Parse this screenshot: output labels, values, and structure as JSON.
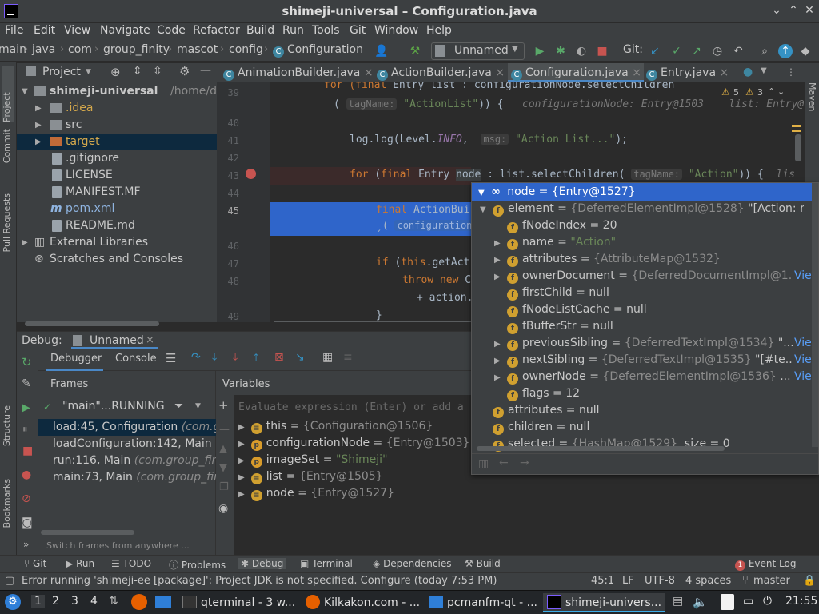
{
  "window": {
    "title": "shimeji-universal – Configuration.java"
  },
  "menu": [
    "File",
    "Edit",
    "View",
    "Navigate",
    "Code",
    "Refactor",
    "Build",
    "Run",
    "Tools",
    "Git",
    "Window",
    "Help"
  ],
  "breadcrumbs": [
    "main",
    "java",
    "com",
    "group_finity",
    "mascot",
    "config",
    "Configuration"
  ],
  "run_config": "Unnamed",
  "git_label": "Git:",
  "project_panel": {
    "title": "Project",
    "root_name": "shimeji-universal",
    "root_path": "/home/dartz",
    "items": [
      ".idea",
      "src",
      "target",
      ".gitignore",
      "LICENSE",
      "MANIFEST.MF",
      "pom.xml",
      "README.md",
      "External Libraries",
      "Scratches and Consoles"
    ]
  },
  "editor_tabs": [
    "AnimationBuilder.java",
    "ActionBuilder.java",
    "Configuration.java",
    "Entry.java"
  ],
  "editor_warnings": {
    "warnings": "5",
    "weak": "3"
  },
  "side_tabs": {
    "left": [
      "Project",
      "Commit",
      "Pull Requests",
      "Structure",
      "Bookmarks"
    ],
    "right": [
      "Maven"
    ]
  },
  "code_lines": [
    {
      "num": "39",
      "text": "for (final Entry list : configurationNode.selectChildren"
    },
    {
      "num": "",
      "text": "( tagName: \"ActionList\")) {   configurationNode: Entry@1503    list: Entry@"
    },
    {
      "num": "40",
      "text": ""
    },
    {
      "num": "41",
      "text": "log.log(Level.INFO,  msg: \"Action List...\");"
    },
    {
      "num": "42",
      "text": ""
    },
    {
      "num": "43",
      "text": "for (final Entry node : list.selectChildren( tagName: \"Action\")) {  lis"
    },
    {
      "num": "44",
      "text": ""
    },
    {
      "num": "45",
      "text": "final ActionBui"
    },
    {
      "num": "",
      "text": "ˏ( configuration:"
    },
    {
      "num": "46",
      "text": ""
    },
    {
      "num": "47",
      "text": "if (this.getAct"
    },
    {
      "num": "48",
      "text": "throw new C"
    },
    {
      "num": "",
      "text": "+ action."
    },
    {
      "num": "49",
      "text": "}"
    }
  ],
  "code_tokens": {
    "l39_for": "for",
    "l39_final": "(final",
    "l39_rest": " Entry list : configurationNode.selectChildren",
    "l39b_open": "(",
    "l39b_hint": "tagName:",
    "l39b_str": "\"ActionList\"",
    "l39b_close": ")) {",
    "l39b_h1": "configurationNode: Entry@1503",
    "l39b_h2": "list: Entry@",
    "l41_log": "log.log(Level.",
    "l41_info": "INFO",
    "l41_comma": ",",
    "l41_hint": "msg:",
    "l41_str": "\"Action List...\"",
    "l41_end": ");",
    "l43_for": "for",
    "l43_p1": " (",
    "l43_final": "final",
    "l43_p2": " Entry ",
    "l43_node": "node",
    "l43_p3": " : list.selectChildren(",
    "l43_hint": "tagName:",
    "l43_str": "\"Action\"",
    "l43_close": ")) {",
    "l43_lis": "lis",
    "l45_final": "final",
    "l45_rest": " ActionBui",
    "l45b_open": "ˏ(",
    "l45b_hint": "configuration:",
    "l47_if": "if",
    "l47_p1": " (",
    "l47_this": "this",
    "l47_rest": ".getAct",
    "l48_throw": "throw",
    "l48_new": "new",
    "l48_rest": " C",
    "l48b_rest": "+ action.",
    "l49_brace": "}"
  },
  "debug": {
    "label": "Debug:",
    "config": "Unnamed",
    "tab_debugger": "Debugger",
    "tab_console": "Console",
    "frames_title": "Frames",
    "variables_title": "Variables",
    "thread": "\"main\"...RUNNING",
    "frames": [
      {
        "method": "load:45, Configuration",
        "pkg": "(com.gr"
      },
      {
        "method": "loadConfiguration:142, Main",
        "pkg": "(c"
      },
      {
        "method": "run:116, Main",
        "pkg": "(com.group_finit"
      },
      {
        "method": "main:73, Main",
        "pkg": "(com.group_fini"
      }
    ],
    "frames_hint": "Switch frames from anywhere ...",
    "evaluate_placeholder": "Evaluate expression (Enter) or add a",
    "variables": [
      {
        "icon": "≡",
        "name": "this",
        "value": "{Configuration@1506}",
        "kind": "obj"
      },
      {
        "icon": "p",
        "name": "configurationNode",
        "value": "{Entry@1503}",
        "kind": "obj"
      },
      {
        "icon": "p",
        "name": "imageSet",
        "value": "\"Shimeji\"",
        "kind": "str"
      },
      {
        "icon": "≡",
        "name": "list",
        "value": "{Entry@1505}",
        "kind": "obj"
      },
      {
        "icon": "≡",
        "name": "node",
        "value": "{Entry@1527}",
        "kind": "obj"
      }
    ]
  },
  "popup": {
    "header": "node = {Entry@1527}",
    "rows": [
      {
        "indent": 1,
        "expand": "v",
        "name": "element",
        "eq": " = ",
        "value": "{DeferredElementImpl@1528}",
        "extra": " \"[Action: null]\"",
        "link": ""
      },
      {
        "indent": 2,
        "expand": "",
        "name": "fNodeIndex",
        "eq": " = ",
        "value": "20",
        "extra": "",
        "link": "",
        "num": true
      },
      {
        "indent": 2,
        "expand": ">",
        "name": "name",
        "eq": " = ",
        "value": "\"Action\"",
        "extra": "",
        "link": "",
        "str": true
      },
      {
        "indent": 2,
        "expand": ">",
        "name": "attributes",
        "eq": " = ",
        "value": "{AttributeMap@1532}",
        "extra": "",
        "link": ""
      },
      {
        "indent": 2,
        "expand": ">",
        "name": "ownerDocument",
        "eq": " = ",
        "value": "{DeferredDocumentImpl@1...",
        "extra": "",
        "link": "View"
      },
      {
        "indent": 2,
        "expand": "",
        "name": "firstChild",
        "eq": " = ",
        "value": "null",
        "extra": "",
        "link": "",
        "num": true
      },
      {
        "indent": 2,
        "expand": "",
        "name": "fNodeListCache",
        "eq": " = ",
        "value": "null",
        "extra": "",
        "link": "",
        "num": true
      },
      {
        "indent": 2,
        "expand": "",
        "name": "fBufferStr",
        "eq": " = ",
        "value": "null",
        "extra": "",
        "link": "",
        "num": true
      },
      {
        "indent": 2,
        "expand": ">",
        "name": "previousSibling",
        "eq": " = ",
        "value": "{DeferredTextImpl@1534}",
        "extra": " \"...",
        "link": "View"
      },
      {
        "indent": 2,
        "expand": ">",
        "name": "nextSibling",
        "eq": " = ",
        "value": "{DeferredTextImpl@1535}",
        "extra": " \"[#te...",
        "link": "View"
      },
      {
        "indent": 2,
        "expand": ">",
        "name": "ownerNode",
        "eq": " = ",
        "value": "{DeferredElementImpl@1536}",
        "extra": " ...",
        "link": "View"
      },
      {
        "indent": 2,
        "expand": "",
        "name": "flags",
        "eq": " = ",
        "value": "12",
        "extra": "",
        "link": "",
        "num": true
      },
      {
        "indent": 1,
        "expand": "",
        "name": "attributes",
        "eq": " = ",
        "value": "null",
        "extra": "",
        "link": "",
        "num": true
      },
      {
        "indent": 1,
        "expand": "",
        "name": "children",
        "eq": " = ",
        "value": "null",
        "extra": "",
        "link": "",
        "num": true
      },
      {
        "indent": 1,
        "expand": "",
        "name": "selected",
        "eq": " = ",
        "value": "{HashMap@1529}",
        "extra": "  size = 0",
        "link": ""
      }
    ]
  },
  "toolwindows": [
    "Git",
    "Run",
    "TODO",
    "Problems",
    "Debug",
    "Terminal",
    "Dependencies",
    "Build",
    "Event Log"
  ],
  "event_log_count": "1",
  "status": {
    "message": "Error running 'shimeji-ee [package]': Project JDK is not specified. Configure (today 7:53 PM)",
    "position": "45:1",
    "line_sep": "LF",
    "encoding": "UTF-8",
    "indent": "4 spaces",
    "branch": "master"
  },
  "taskbar": {
    "workspaces": [
      "1",
      "2",
      "3",
      "4"
    ],
    "tasks": [
      "qterminal - 3 w...",
      "Kilkakon.com - ...",
      "pcmanfm-qt - ...",
      "shimeji-univers..."
    ],
    "clock": "21:55"
  },
  "colors": {
    "accent": "#2f65ca",
    "selection": "#2f65ca",
    "editor_bg": "#2b2b2b",
    "panel_bg": "#3c3f41"
  }
}
